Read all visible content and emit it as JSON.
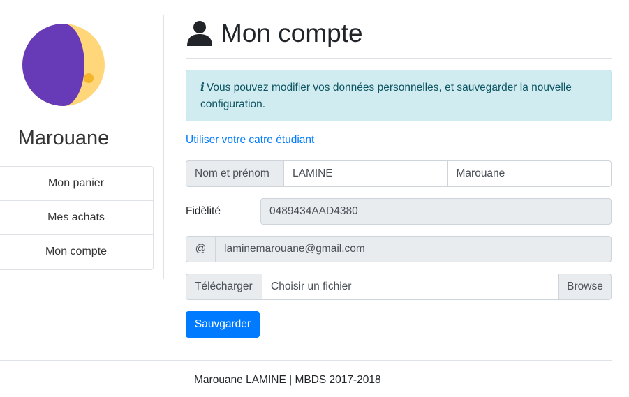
{
  "sidebar": {
    "avatar_icon": "moon-avatar-icon",
    "user_name": "Marouane",
    "items": [
      {
        "label": "Mon panier"
      },
      {
        "label": "Mes achats"
      },
      {
        "label": "Mon compte"
      }
    ]
  },
  "main": {
    "title_icon": "user-icon",
    "title": "Mon compte",
    "alert": {
      "icon": "i",
      "text": "Vous pouvez modifier vos données personnelles, et sauvegarder la nouvelle configuration."
    },
    "student_card_link": "Utiliser votre catre étudiant",
    "name_group": {
      "label": "Nom et prénom",
      "last_name": "LAMINE",
      "first_name": "Marouane"
    },
    "fidelity": {
      "label": "Fidèlité",
      "value": "0489434AAD4380"
    },
    "email": {
      "prefix": "@",
      "value": "laminemarouane@gmail.com"
    },
    "upload": {
      "label": "Télécharger",
      "placeholder": "Choisir un fichier",
      "browse_label": "Browse"
    },
    "save_label": "Sauvgarder"
  },
  "footer": {
    "text": "Marouane LAMINE | MBDS 2017-2018"
  },
  "colors": {
    "primary": "#007bff",
    "alert_bg": "#d1ecf1",
    "alert_text": "#0c5460",
    "avatar_purple": "#673ab7",
    "avatar_yellow": "#ffd67a"
  }
}
